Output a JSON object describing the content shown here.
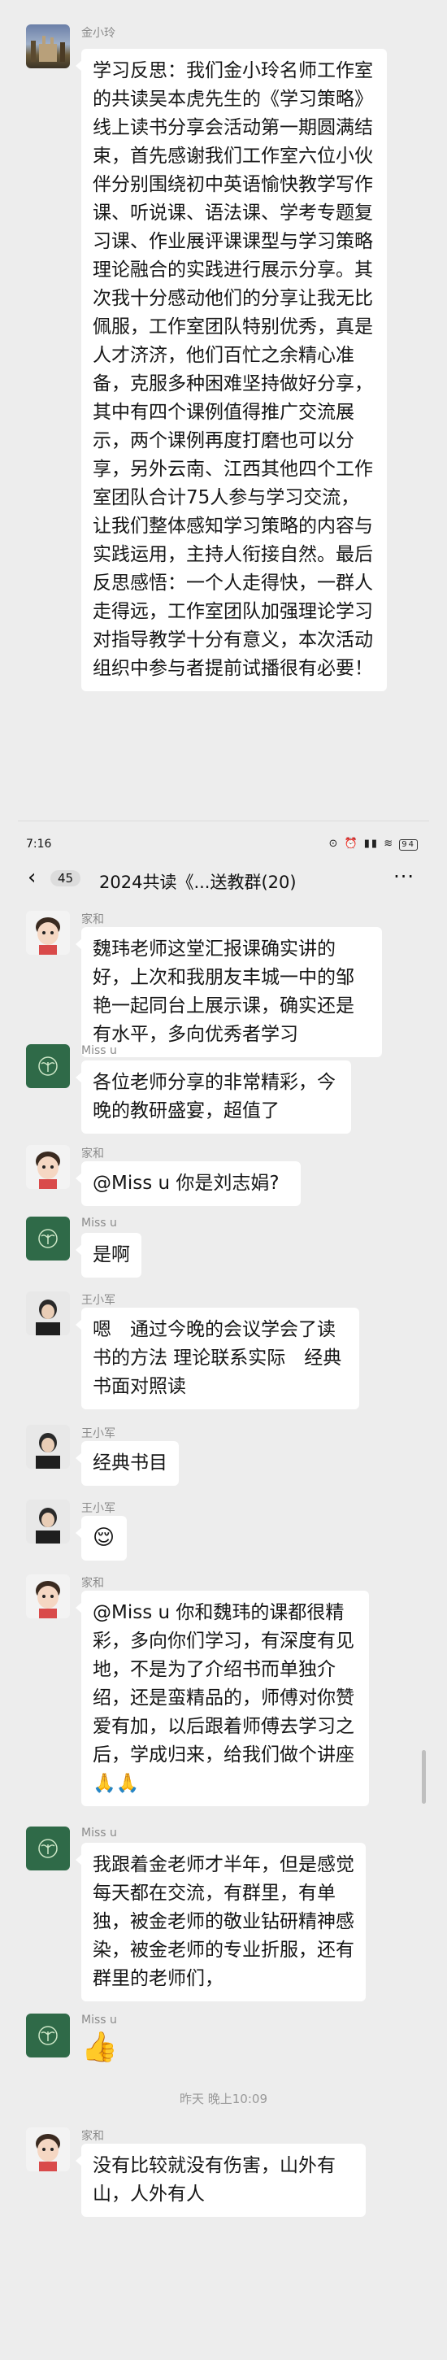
{
  "top_message": {
    "sender": "金小玲",
    "text": "学习反思：我们金小玲名师工作室的共读吴本虎先生的《学习策略》线上读书分享会活动第一期圆满结束，首先感谢我们工作室六位小伙伴分别围绕初中英语愉快教学写作课、听说课、语法课、学考专题复习课、作业展评课课型与学习策略理论融合的实践进行展示分享。其次我十分感动他们的分享让我无比佩服，工作室团队特别优秀，真是人才济济，他们百忙之余精心准备，克服多种困难坚持做好分享，其中有四个课例值得推广交流展示，两个课例再度打磨也可以分享，另外云南、江西其他四个工作室团队合计75人参与学习交流，让我们整体感知学习策略的内容与实践运用，主持人衔接自然。最后反思感悟：一个人走得快，一群人走得远，工作室团队加强理论学习对指导教学十分有意义，本次活动组织中参与者提前试播很有必要！"
  },
  "status_bar": {
    "time": "7:16",
    "icons": "⊙ ⏰ ▮▮ ≋",
    "battery": "94"
  },
  "chat": {
    "back_icon": "‹",
    "unread_count": "45",
    "title": "2024共读《...送教群(20)",
    "more_icon": "···"
  },
  "messages": [
    {
      "sender": "家和",
      "text": "魏玮老师这堂汇报课确实讲的好，上次和我朋友丰城一中的邹艳一起同台上展示课，确实还是有水平，多向优秀者学习"
    },
    {
      "sender": "Miss u",
      "text": "各位老师分享的非常精彩，今晚的教研盛宴，超值了"
    },
    {
      "sender": "家和",
      "text": "@Miss u 你是刘志娟?"
    },
    {
      "sender": "Miss u",
      "text": "是啊"
    },
    {
      "sender": "王小军",
      "text": "嗯　通过今晚的会议学会了读书的方法 理论联系实际　经典书面对照读"
    },
    {
      "sender": "王小军",
      "text": "经典书目"
    },
    {
      "sender": "王小军",
      "text": "😌"
    },
    {
      "sender": "家和",
      "text": "@Miss u 你和魏玮的课都很精彩，多向你们学习，有深度有见地，不是为了介绍书而单独介绍，还是蛮精品的，师傅对你赞爱有加，以后跟着师傅去学习之后，学成归来，给我们做个讲座🙏🙏"
    },
    {
      "sender": "Miss u",
      "text": "我跟着金老师才半年，但是感觉每天都在交流，有群里，有单独，被金老师的敬业钻研精神感染，被金老师的专业折服，还有群里的老师们，"
    },
    {
      "sender": "Miss u",
      "text": "👍"
    },
    {
      "sender": "家和",
      "text": "没有比较就没有伤害，山外有山，人外有人"
    }
  ],
  "timestamp": "昨天 晚上10:09",
  "colors": {
    "background": "#ededed",
    "bubble": "#ffffff",
    "avatar_green": "#2f6a48",
    "name_gray": "#8b8b8b"
  }
}
